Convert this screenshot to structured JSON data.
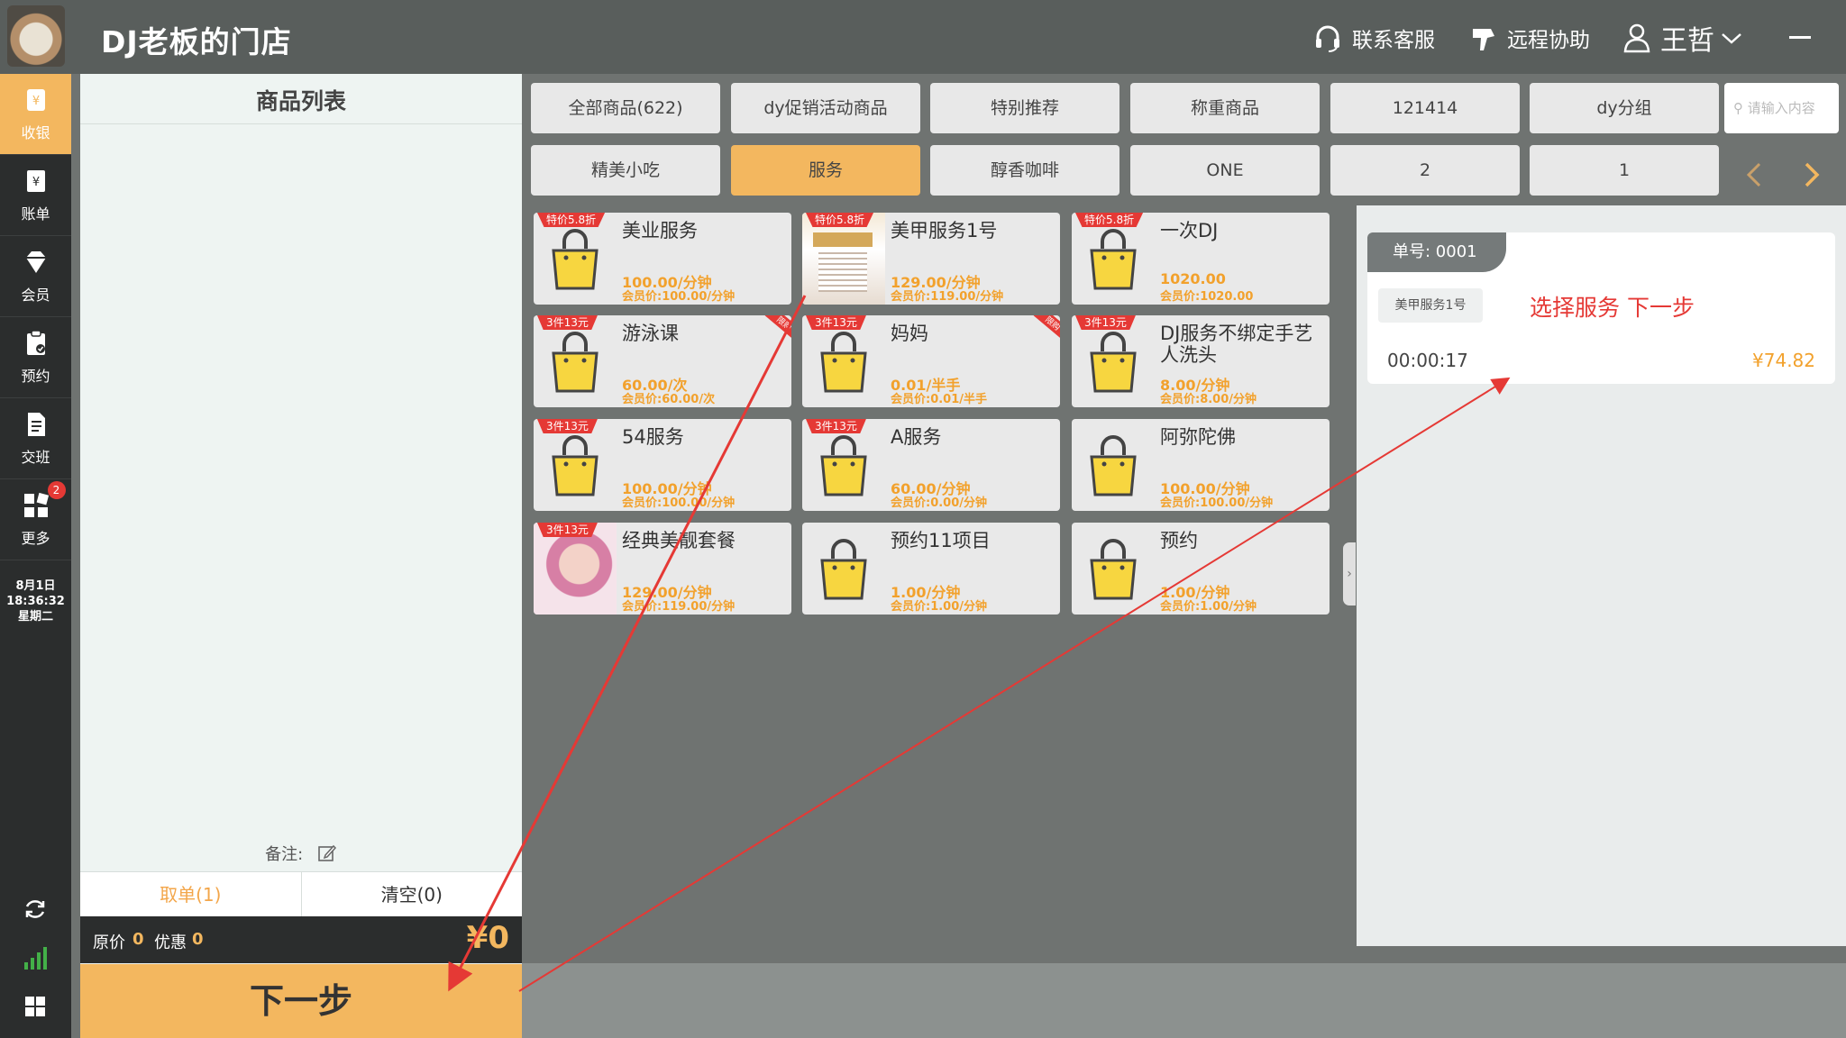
{
  "header": {
    "shop_name": "DJ老板的门店",
    "customer_service": "联系客服",
    "remote_help": "远程协助",
    "user_name": "王哲"
  },
  "sidenav": {
    "items": [
      {
        "label": "收银",
        "icon": "cashier-icon",
        "active": true
      },
      {
        "label": "账单",
        "icon": "bill-icon"
      },
      {
        "label": "会员",
        "icon": "diamond-icon"
      },
      {
        "label": "预约",
        "icon": "clipboard-icon"
      },
      {
        "label": "交班",
        "icon": "document-icon"
      },
      {
        "label": "更多",
        "icon": "grid-icon",
        "badge": "2"
      }
    ],
    "date": "8月1日",
    "time": "18:36:32",
    "weekday": "星期二"
  },
  "left_panel": {
    "title": "商品列表",
    "remark_label": "备注:",
    "take_order": "取单(1)",
    "clear": "清空(0)",
    "original_label": "原价",
    "original_value": "0",
    "discount_label": "优惠",
    "discount_value": "0",
    "total": "¥0",
    "next": "下一步"
  },
  "categories": [
    {
      "label": "全部商品(622)"
    },
    {
      "label": "dy促销活动商品"
    },
    {
      "label": "特别推荐"
    },
    {
      "label": "称重商品"
    },
    {
      "label": "121414"
    },
    {
      "label": "dy分组"
    },
    {
      "label": "精美小吃"
    },
    {
      "label": "服务",
      "active": true
    },
    {
      "label": "醇香咖啡"
    },
    {
      "label": "ONE"
    },
    {
      "label": "2"
    },
    {
      "label": "1"
    }
  ],
  "search_placeholder": "请输入内容",
  "products": [
    {
      "name": "美业服务",
      "tag": "特价5.8折",
      "price": "100.00/分钟",
      "member": "会员价:100.00/分钟"
    },
    {
      "name": "美甲服务1号",
      "tag": "特价5.8折",
      "price": "129.00/分钟",
      "member": "会员价:119.00/分钟",
      "image": "poster"
    },
    {
      "name": "一次DJ",
      "tag": "特价5.8折",
      "price": "1020.00",
      "member": "会员价:1020.00"
    },
    {
      "name": "游泳课",
      "tag": "3件13元",
      "corner": "限购",
      "price": "60.00/次",
      "member": "会员价:60.00/次"
    },
    {
      "name": "妈妈",
      "tag": "3件13元",
      "corner": "限购",
      "price": "0.01/半手",
      "member": "会员价:0.01/半手"
    },
    {
      "name": "DJ服务不绑定手艺人洗头",
      "tag": "3件13元",
      "price": "8.00/分钟",
      "member": "会员价:8.00/分钟"
    },
    {
      "name": "54服务",
      "tag": "3件13元",
      "price": "100.00/分钟",
      "member": "会员价:100.00/分钟"
    },
    {
      "name": "A服务",
      "tag": "3件13元",
      "price": "60.00/分钟",
      "member": "会员价:0.00/分钟"
    },
    {
      "name": "阿弥陀佛",
      "price": "100.00/分钟",
      "member": "会员价:100.00/分钟"
    },
    {
      "name": "经典美靓套餐",
      "tag": "3件13元",
      "price": "129.00/分钟",
      "member": "会员价:119.00/分钟",
      "image": "portrait"
    },
    {
      "name": "预约11项目",
      "price": "1.00/分钟",
      "member": "会员价:1.00/分钟"
    },
    {
      "name": "预约",
      "price": "1.00/分钟",
      "member": "会员价:1.00/分钟"
    }
  ],
  "order": {
    "number": "单号: 0001",
    "item": "美甲服务1号",
    "hint": "选择服务 下一步",
    "time": "00:00:17",
    "amount": "¥74.82"
  },
  "colors": {
    "accent": "#f3b75f",
    "price": "#f2a12c",
    "annotation": "#e53935",
    "nav_bg": "#2b2d2d"
  }
}
